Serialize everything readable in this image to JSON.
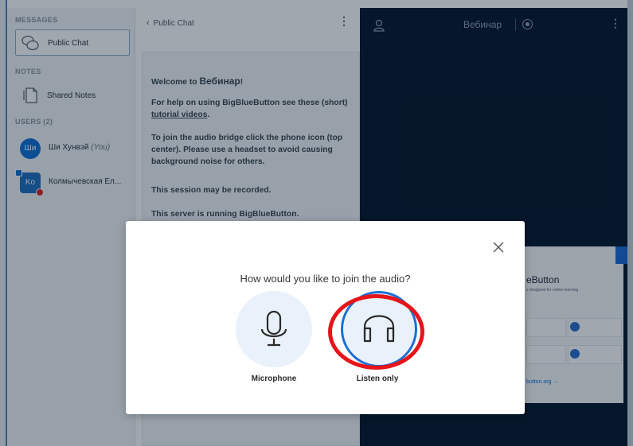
{
  "userlist": {
    "messages_title": "MESSAGES",
    "public_chat": "Public Chat",
    "notes_title": "NOTES",
    "shared_notes": "Shared Notes",
    "users_title": "USERS (2)",
    "users": [
      {
        "initials": "Ши",
        "name": "Ши Хунвэй",
        "you": "(You)",
        "color": "#0f70d7"
      },
      {
        "initials": "Ko",
        "name": "Колмычевская Ел...",
        "you": "",
        "color": "#1f6fbf"
      }
    ]
  },
  "chat": {
    "back_label": "Public Chat",
    "welcome_prefix": "Welcome to ",
    "welcome_name": "Вебинар",
    "welcome_suffix": "!",
    "help_text": "For help on using BigBlueButton see these (short) ",
    "help_link": "tutorial videos",
    "help_end": ".",
    "audio_text_1": "To join the audio bridge click the phone icon (top center). ",
    "audio_text_bold": "Please use a headset to avoid causing background noise for others.",
    "recorded": "This session may be recorded.",
    "server": "This server is running BigBlueButton."
  },
  "presentation": {
    "title": "Вебинар",
    "slide_title": "eButton",
    "slide_sub": "s designed for online learning",
    "slide_link": "button.org →"
  },
  "modal": {
    "question": "How would you like to join the audio?",
    "options": [
      {
        "label": "Microphone",
        "icon": "microphone-icon"
      },
      {
        "label": "Listen only",
        "icon": "headphones-icon"
      }
    ]
  },
  "colors": {
    "accent": "#1c6fd3",
    "highlight": "#e5151a",
    "presentation_bg": "#06172a"
  }
}
